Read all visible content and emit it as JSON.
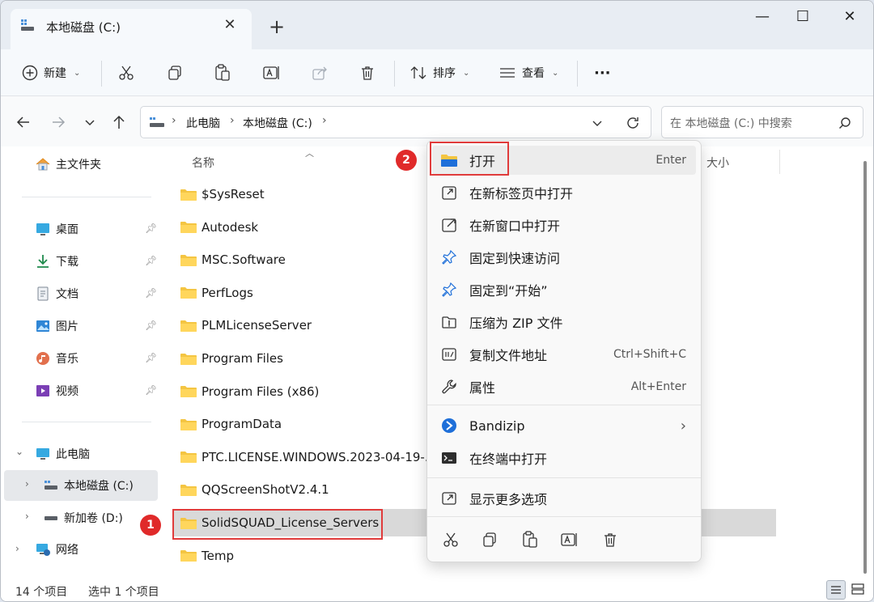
{
  "titlebar": {
    "tab_title": "本地磁盘 (C:)",
    "close_tab": "✕",
    "new_tab": "+",
    "minimize": "—",
    "maximize": "☐",
    "close_window": "✕"
  },
  "toolbar": {
    "new_label": "新建",
    "sort_label": "排序",
    "view_label": "查看",
    "more_label": "···"
  },
  "address": {
    "crumbs": [
      "此电脑",
      "本地磁盘 (C:)"
    ],
    "search_placeholder": "在 本地磁盘 (C:) 中搜索"
  },
  "sidebar": {
    "home": "主文件夹",
    "quick": [
      "桌面",
      "下载",
      "文档",
      "图片",
      "音乐",
      "视频"
    ],
    "this_pc": "此电脑",
    "drives": [
      "本地磁盘 (C:)",
      "新加卷 (D:)"
    ],
    "network": "网络"
  },
  "filelist": {
    "col_name": "名称",
    "col_size": "大小",
    "files": [
      "$SysReset",
      "Autodesk",
      "MSC.Software",
      "PerfLogs",
      "PLMLicenseServer",
      "Program Files",
      "Program Files (x86)",
      "ProgramData",
      "PTC.LICENSE.WINDOWS.2023-04-19-...",
      "QQScreenShotV2.4.1",
      "SolidSQUAD_License_Servers",
      "Temp"
    ],
    "selected_index": 10
  },
  "badges": {
    "one": "1",
    "two": "2"
  },
  "context_menu": {
    "items": [
      {
        "label": "打开",
        "shortcut": "Enter",
        "icon": "folder-icon"
      },
      {
        "label": "在新标签页中打开",
        "shortcut": "",
        "icon": "new-tab-icon"
      },
      {
        "label": "在新窗口中打开",
        "shortcut": "",
        "icon": "new-window-icon"
      },
      {
        "label": "固定到快速访问",
        "shortcut": "",
        "icon": "pin-icon"
      },
      {
        "label": "固定到“开始”",
        "shortcut": "",
        "icon": "pin-start-icon"
      },
      {
        "label": "压缩为 ZIP 文件",
        "shortcut": "",
        "icon": "zip-icon"
      },
      {
        "label": "复制文件地址",
        "shortcut": "Ctrl+Shift+C",
        "icon": "copy-path-icon"
      },
      {
        "label": "属性",
        "shortcut": "Alt+Enter",
        "icon": "wrench-icon"
      },
      {
        "label": "Bandizip",
        "shortcut": "",
        "icon": "bandizip-icon"
      },
      {
        "label": "在终端中打开",
        "shortcut": "",
        "icon": "terminal-icon"
      },
      {
        "label": "显示更多选项",
        "shortcut": "",
        "icon": "more-options-icon"
      }
    ],
    "submenu_arrow": "›"
  },
  "status": {
    "count": "14 个项目",
    "selected": "选中 1 个项目"
  },
  "colors": {
    "folder": "#f4c542",
    "highlight": "#e03b3b",
    "accent": "#0067c0"
  }
}
